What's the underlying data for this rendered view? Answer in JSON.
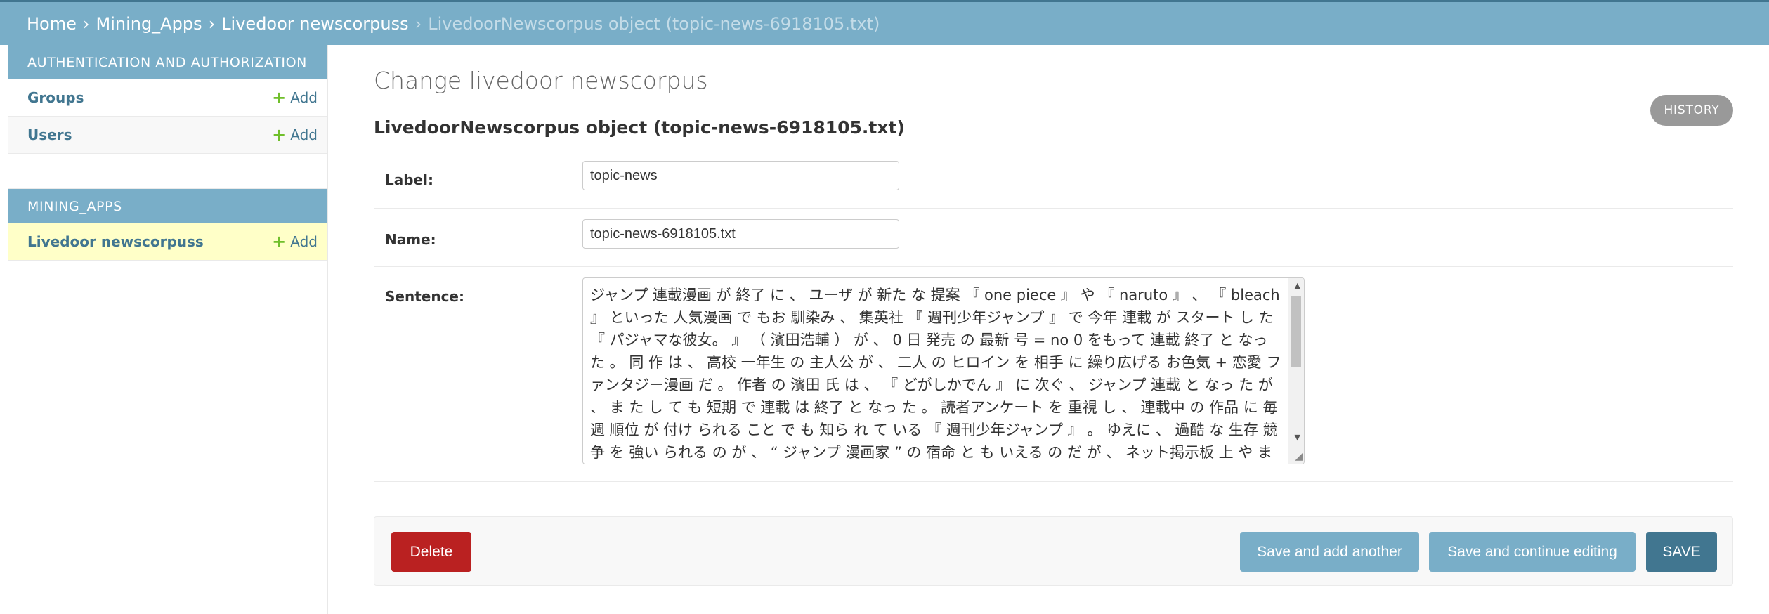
{
  "breadcrumbs": {
    "home": "Home",
    "app": "Mining_Apps",
    "model": "Livedoor newscorpuss",
    "current": "LivedoorNewscorpus object (topic-news-6918105.txt)",
    "separator": "›"
  },
  "sidebar": {
    "auth": {
      "caption": "AUTHENTICATION AND AUTHORIZATION",
      "items": [
        {
          "label": "Groups",
          "add": "Add"
        },
        {
          "label": "Users",
          "add": "Add"
        }
      ]
    },
    "mining": {
      "caption": "MINING_APPS",
      "items": [
        {
          "label": "Livedoor newscorpuss",
          "add": "Add"
        }
      ]
    },
    "plus": "+"
  },
  "main": {
    "title": "Change livedoor newscorpus",
    "history": "HISTORY",
    "object_heading": "LivedoorNewscorpus object (topic-news-6918105.txt)",
    "fields": {
      "label": {
        "label": "Label:",
        "value": "topic-news"
      },
      "name": {
        "label": "Name:",
        "value": "topic-news-6918105.txt"
      },
      "sentence": {
        "label": "Sentence:",
        "value": "ジャンプ 連載漫画 が 終了 に 、 ユーザ が 新た な 提案 『 one piece 』 や 『 naruto 』 、 『 bleach 』 といった 人気漫画 で もお 馴染み 、 集英社 『 週刊少年ジャンプ 』 で 今年 連載 が スタート し た 『 パジャマな彼女。 』 （ 濱田浩輔 ） が 、 0 日 発売 の 最新 号 = no 0 をもって 連載 終了 と なっ た 。 同 作 は 、 高校 一年生 の 主人公 が 、 二人 の ヒロイン を 相手 に 繰り広げる お色気 + 恋愛 ファンタジー漫画 だ 。 作者 の 濱田 氏 は 、 『 どがしかでん 』 に 次ぐ 、 ジャンプ 連載 と なっ た が 、 ま た し て も 短期 で 連載 は 終了 と なっ た 。 読者アンケート を 重視 し 、 連載中 の 作品 に 毎週 順位 が 付け られる こと で も 知ら れ て いる 『 週刊少年ジャンプ 』 。 ゆえに 、 過酷 な 生存 競争 を 強い られる の が 、 “ ジャンプ 漫画家 ” の 宿命 と も いえる の だ が 、 ネット掲示板 上 や まとめサイ"
      }
    },
    "buttons": {
      "delete": "Delete",
      "save_add_another": "Save and add another",
      "save_continue": "Save and continue editing",
      "save": "SAVE"
    }
  },
  "colors": {
    "header": "#79aec8",
    "primary": "#417690",
    "delete": "#ba2121",
    "selected_row": "#ffffc8",
    "add_plus": "#70bf2b"
  }
}
